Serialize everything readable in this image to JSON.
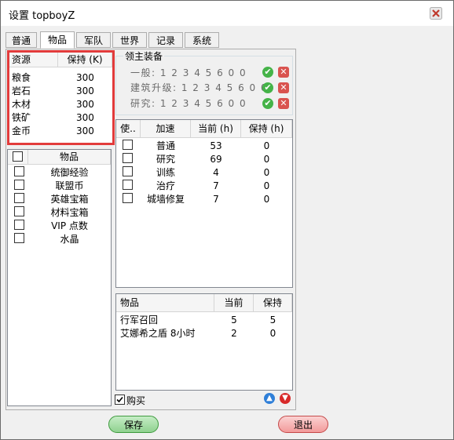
{
  "window": {
    "title": "设置 topboyZ"
  },
  "tabs": [
    "普通",
    "物品",
    "军队",
    "世界",
    "记录",
    "系统"
  ],
  "active_tab": "物品",
  "resources": {
    "headers": [
      "资源",
      "保持 (K)"
    ],
    "rows": [
      {
        "name": "粮食",
        "keep": "300"
      },
      {
        "name": "岩石",
        "keep": "300"
      },
      {
        "name": "木材",
        "keep": "300"
      },
      {
        "name": "铁矿",
        "keep": "300"
      },
      {
        "name": "金币",
        "keep": "300"
      }
    ]
  },
  "items_list": {
    "header": "物品",
    "rows": [
      "统御经验",
      "联盟币",
      "英雄宝箱",
      "材料宝箱",
      "VIP 点数",
      "水晶"
    ]
  },
  "lord_equipment": {
    "legend": "领主装备",
    "rows": [
      {
        "label": "一般: 1 2 3 4 5 6 0 0"
      },
      {
        "label": "建筑升级: 1 2 3 4 5 6 0 0"
      },
      {
        "label": "研究: 1 2 3 4 5 6 0 0"
      }
    ]
  },
  "speedups": {
    "headers": [
      "使..",
      "加速",
      "当前 (h)",
      "保持 (h)"
    ],
    "rows": [
      {
        "name": "普通",
        "current": "53",
        "keep": "0"
      },
      {
        "name": "研究",
        "current": "69",
        "keep": "0"
      },
      {
        "name": "训练",
        "current": "4",
        "keep": "0"
      },
      {
        "name": "治疗",
        "current": "7",
        "keep": "0"
      },
      {
        "name": "城墙修复",
        "current": "7",
        "keep": "0"
      }
    ]
  },
  "goods": {
    "headers": [
      "物品",
      "当前",
      "保持"
    ],
    "rows": [
      {
        "name": "行军召回",
        "current": "5",
        "keep": "5"
      },
      {
        "name": "艾娜希之盾 8小时",
        "current": "2",
        "keep": "0"
      }
    ]
  },
  "buy_checkbox": {
    "label": "购买",
    "checked": true
  },
  "buttons": {
    "save": "保存",
    "exit": "退出"
  },
  "colors": {
    "highlight": "#e23b3b",
    "save_btn": "#8fd18f",
    "exit_btn": "#f29a9a",
    "arrow_up": "#2f7fd8",
    "arrow_down": "#d82a2a"
  }
}
